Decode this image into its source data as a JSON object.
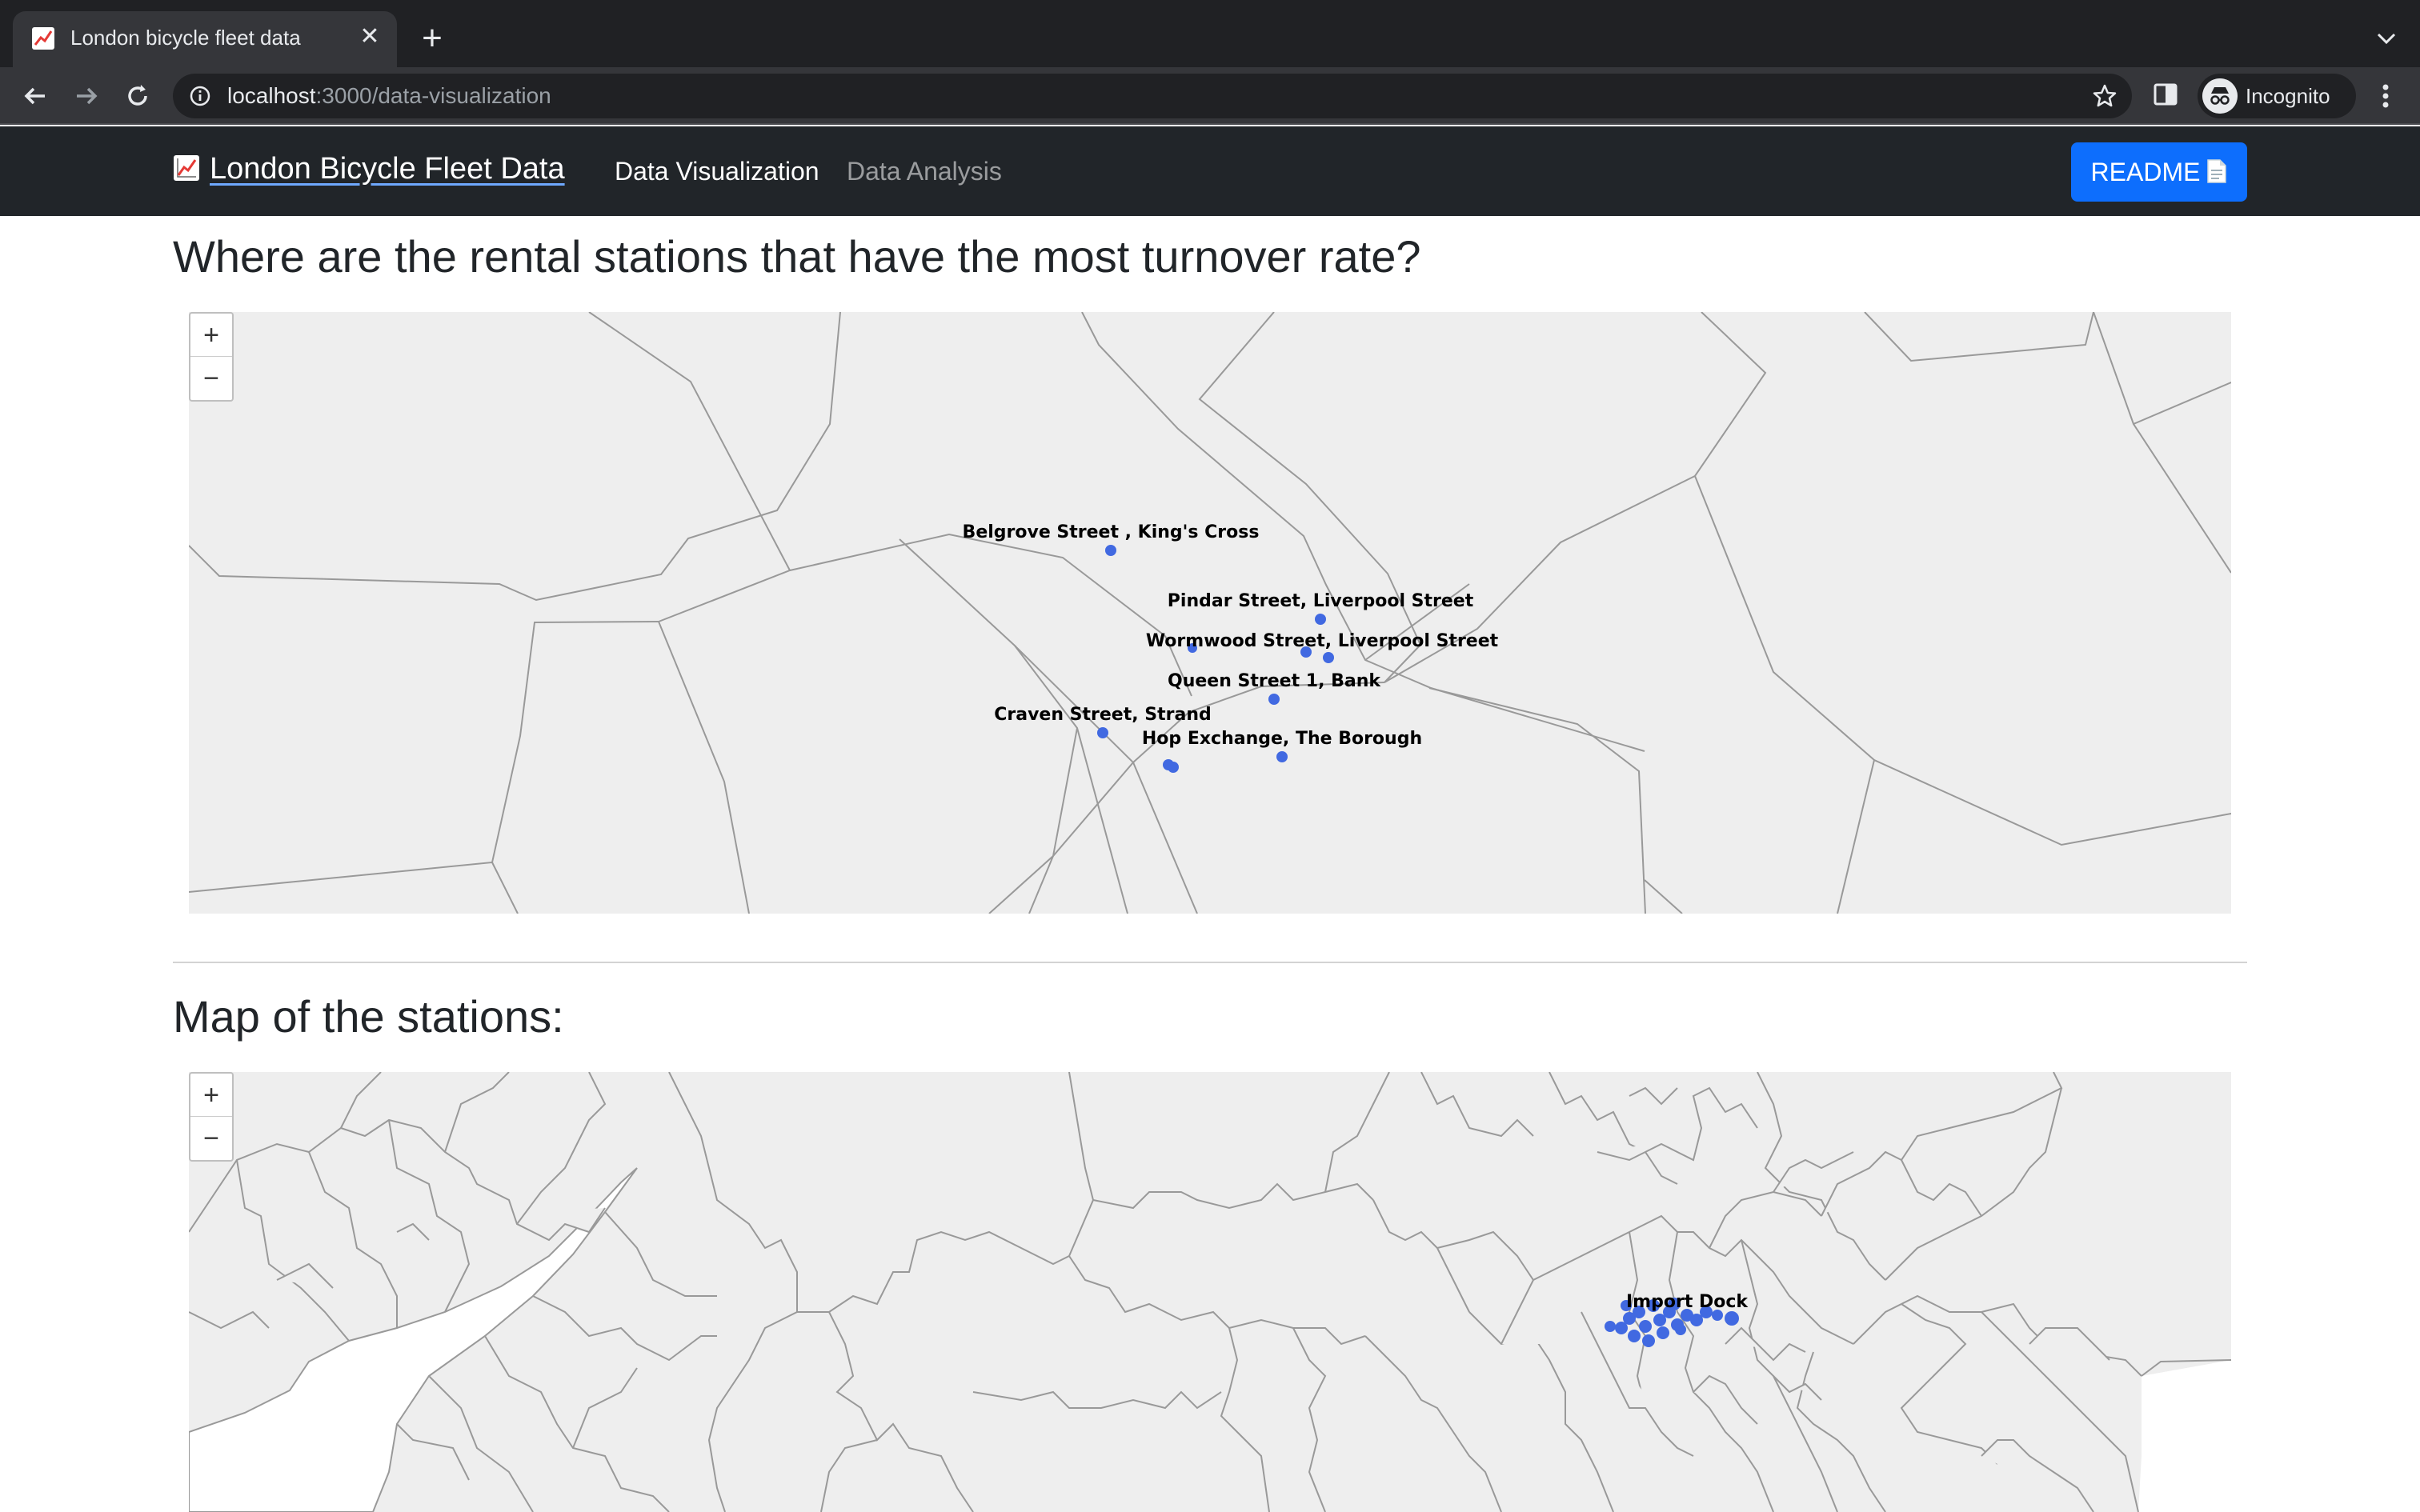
{
  "browser": {
    "tab_title": "London bicycle fleet data",
    "url_host": "localhost",
    "url_path": ":3000/data-visualization",
    "profile_label": "Incognito"
  },
  "navbar": {
    "brand": "London Bicycle Fleet Data",
    "brand_icon": "chart-increasing-emoji",
    "links": [
      {
        "label": "Data Visualization",
        "active": true
      },
      {
        "label": "Data Analysis",
        "active": false
      }
    ],
    "readme_label": "README",
    "readme_icon": "document-icon"
  },
  "sections": {
    "turnover_title": "Where are the rental stations that have the most turnover rate?",
    "stations_title": "Map of the stations:"
  },
  "map_controls": {
    "zoom_in": "+",
    "zoom_out": "−"
  },
  "turnover_map": {
    "stations": [
      "Belgrove Street , King's Cross",
      "Pindar Street, Liverpool Street",
      "Wormwood Street, Liverpool Street",
      "Queen Street 1, Bank",
      "Craven Street, Strand",
      "Hop Exchange, The Borough"
    ]
  },
  "stations_map": {
    "highlighted_station": "Import Dock"
  },
  "colors": {
    "marker": "#4169e1",
    "boundary": "#999999",
    "map_fill": "#eeeeee",
    "primary_button": "#0d6efd",
    "navbar_bg": "#212529"
  }
}
